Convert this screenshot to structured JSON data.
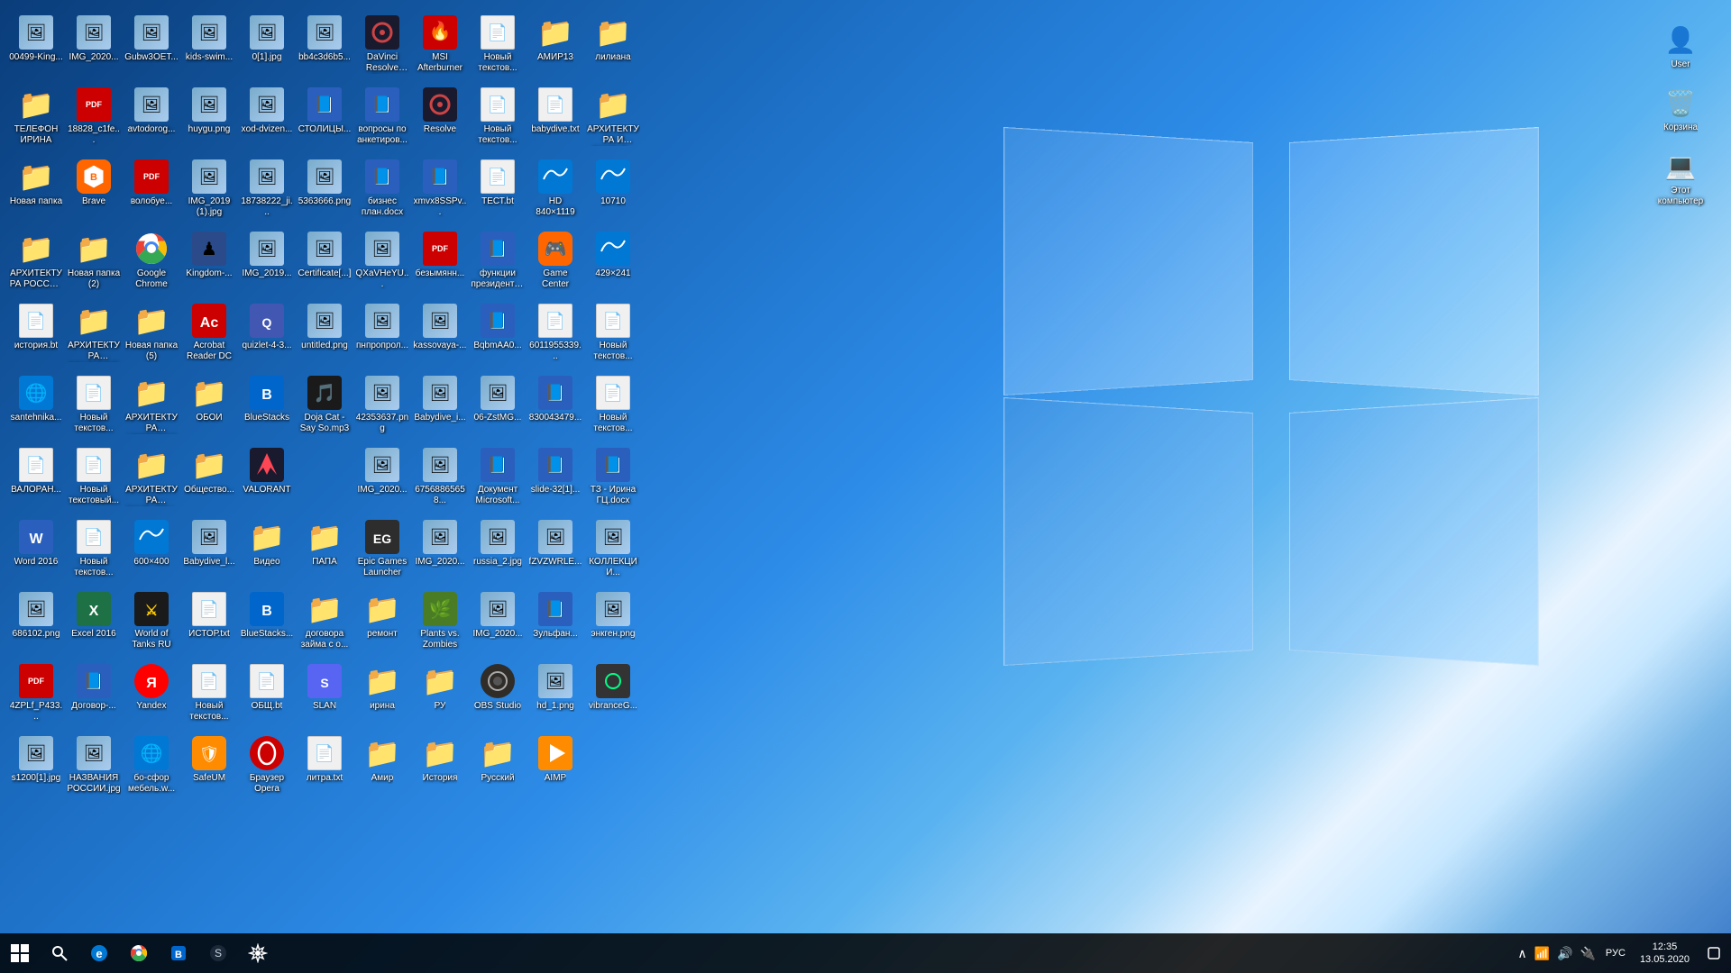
{
  "desktop": {
    "icons": [
      {
        "id": "00499-king",
        "label": "00499-King...",
        "type": "img",
        "emoji": "🖼️"
      },
      {
        "id": "img-2020-1",
        "label": "IMG_2020...",
        "type": "img",
        "emoji": "🖼️"
      },
      {
        "id": "gubw3oet",
        "label": "Gubw3OET...",
        "type": "img",
        "emoji": "🖼️"
      },
      {
        "id": "kids-swim",
        "label": "kids-swim...",
        "type": "img",
        "emoji": "🖼️"
      },
      {
        "id": "0-1-jpg",
        "label": "0[1].jpg",
        "type": "img",
        "emoji": "🖼️"
      },
      {
        "id": "bb4c3d6b",
        "label": "bb4c3d6b5...",
        "type": "img",
        "emoji": "🖼️"
      },
      {
        "id": "davinci",
        "label": "DaVinci Resolve Pro...",
        "type": "app",
        "emoji": "🎬"
      },
      {
        "id": "msi-afterburner",
        "label": "MSI Afterburner",
        "type": "app",
        "emoji": "🔥"
      },
      {
        "id": "new-txt-1",
        "label": "Новый текстов...",
        "type": "txt",
        "emoji": "📄"
      },
      {
        "id": "amir13",
        "label": "АМИР13",
        "type": "folder",
        "emoji": "📁"
      },
      {
        "id": "liliana",
        "label": "лилиана",
        "type": "folder",
        "emoji": "📁"
      },
      {
        "id": "telefon-irina",
        "label": "ТЕЛЕФОН ИРИНА",
        "type": "folder",
        "emoji": "📁"
      },
      {
        "id": "18828-c1fe",
        "label": "18828_c1fe...",
        "type": "pdf",
        "emoji": "📕"
      },
      {
        "id": "avtodorog",
        "label": "avtodorog...",
        "type": "img",
        "emoji": "🖼️"
      },
      {
        "id": "huygu",
        "label": "huygu.png",
        "type": "img",
        "emoji": "🖼️"
      },
      {
        "id": "xod-dvizen",
        "label": "xod-dvizen...",
        "type": "img",
        "emoji": "🖼️"
      },
      {
        "id": "stolicy",
        "label": "СТОЛИЦЫ...",
        "type": "docx",
        "emoji": "📘"
      },
      {
        "id": "voprosy",
        "label": "вопросы по анкетиров...",
        "type": "docx",
        "emoji": "📘"
      },
      {
        "id": "resolve",
        "label": "Resolve",
        "type": "app",
        "emoji": "🎬"
      },
      {
        "id": "new-txt-2",
        "label": "Новый текстов...",
        "type": "txt",
        "emoji": "📄"
      },
      {
        "id": "babydive-txt",
        "label": "babydive.txt",
        "type": "txt",
        "emoji": "📄"
      },
      {
        "id": "arhit-skulp",
        "label": "АРХИТЕКТУРА И СКУЛЬП...",
        "type": "folder",
        "emoji": "📁"
      },
      {
        "id": "new-folder-1",
        "label": "Новая папка",
        "type": "folder",
        "emoji": "📁"
      },
      {
        "id": "brave",
        "label": "Brave",
        "type": "app",
        "emoji": "🦁"
      },
      {
        "id": "voloboy",
        "label": "волобуе...",
        "type": "pdf",
        "emoji": "📕"
      },
      {
        "id": "img-2019-1",
        "label": "IMG_2019 (1).jpg",
        "type": "img",
        "emoji": "🖼️"
      },
      {
        "id": "18738222",
        "label": "18738222_ji...",
        "type": "img",
        "emoji": "🖼️"
      },
      {
        "id": "5363666",
        "label": "5363666.png",
        "type": "img",
        "emoji": "🖼️"
      },
      {
        "id": "biznes-plan",
        "label": "бизнес план.docx",
        "type": "docx",
        "emoji": "📘"
      },
      {
        "id": "xmvx8sspv",
        "label": "xmvx8SSPv...",
        "type": "docx",
        "emoji": "📘"
      },
      {
        "id": "test-txt",
        "label": "ТЕСТ.bt",
        "type": "txt",
        "emoji": "📄"
      },
      {
        "id": "hd840",
        "label": "HD 840×1119",
        "type": "app",
        "emoji": "🌐"
      },
      {
        "id": "10710",
        "label": "10710",
        "type": "app",
        "emoji": "🌐"
      },
      {
        "id": "arhit-russia",
        "label": "АРХИТЕКТУРА РОССИЯ И...",
        "type": "folder",
        "emoji": "📁"
      },
      {
        "id": "new-folder-2",
        "label": "Новая папка (2)",
        "type": "folder",
        "emoji": "📁"
      },
      {
        "id": "google-chrome",
        "label": "Google Chrome",
        "type": "app",
        "emoji": "🌐"
      },
      {
        "id": "kingdom",
        "label": "Kingdom-...",
        "type": "app",
        "emoji": "🎮"
      },
      {
        "id": "img-2019-2",
        "label": "IMG_2019...",
        "type": "img",
        "emoji": "🖼️"
      },
      {
        "id": "certificate",
        "label": "Certificate[...]",
        "type": "img",
        "emoji": "🖼️"
      },
      {
        "id": "qxavheyu",
        "label": "QXaVHeYU...",
        "type": "img",
        "emoji": "🖼️"
      },
      {
        "id": "bezymyan",
        "label": "безымянн...",
        "type": "pdf",
        "emoji": "📕"
      },
      {
        "id": "funktsii",
        "label": "функции президента...",
        "type": "docx",
        "emoji": "📘"
      },
      {
        "id": "game-center",
        "label": "Game Center",
        "type": "app",
        "emoji": "🎮"
      },
      {
        "id": "429x241",
        "label": "429×241",
        "type": "app",
        "emoji": "🌐"
      },
      {
        "id": "istoriya-txt",
        "label": "история.bt",
        "type": "txt",
        "emoji": "📄"
      },
      {
        "id": "arhit-vlad",
        "label": "АРХИТЕКТУРА ВЛАДИМИР",
        "type": "folder",
        "emoji": "📁"
      },
      {
        "id": "new-folder-5",
        "label": "Новая папка (5)",
        "type": "folder",
        "emoji": "📁"
      },
      {
        "id": "acrobat-dc",
        "label": "Acrobat Reader DC",
        "type": "app",
        "emoji": "📕"
      },
      {
        "id": "quizlet",
        "label": "quizlet-4-3...",
        "type": "app",
        "emoji": "🎓"
      },
      {
        "id": "untitled",
        "label": "untitled.png",
        "type": "img",
        "emoji": "🖼️"
      },
      {
        "id": "pnproprol",
        "label": "пнпропрол...",
        "type": "img",
        "emoji": "🖼️"
      },
      {
        "id": "kassovaya",
        "label": "kassovaya-...",
        "type": "img",
        "emoji": "🖼️"
      },
      {
        "id": "bqbmaa40",
        "label": "BqbmAA0...",
        "type": "docx",
        "emoji": "📘"
      },
      {
        "id": "6011955339",
        "label": "6011955339...",
        "type": "txt",
        "emoji": "📄"
      },
      {
        "id": "new-txt-3",
        "label": "Новый текстов...",
        "type": "txt",
        "emoji": "📄"
      },
      {
        "id": "santehnika",
        "label": "santehnika...",
        "type": "app",
        "emoji": "🌐"
      },
      {
        "id": "new-txt-4",
        "label": "Новый текстов...",
        "type": "txt",
        "emoji": "📄"
      },
      {
        "id": "arhit-novg",
        "label": "АРХИТЕКТУРА НОВГОРОД",
        "type": "folder",
        "emoji": "📁"
      },
      {
        "id": "oboi",
        "label": "ОБОИ",
        "type": "folder",
        "emoji": "📁"
      },
      {
        "id": "bluestacks-1",
        "label": "BlueStacks",
        "type": "app",
        "emoji": "📱"
      },
      {
        "id": "doja-cat",
        "label": "Doja Cat - Say So.mp3",
        "type": "app",
        "emoji": "🎵"
      },
      {
        "id": "42353637",
        "label": "42353637.png",
        "type": "img",
        "emoji": "🖼️"
      },
      {
        "id": "babydive-img",
        "label": "Babydive_i...",
        "type": "img",
        "emoji": "🖼️"
      },
      {
        "id": "06-zstmg",
        "label": "06-ZstMG...",
        "type": "img",
        "emoji": "🖼️"
      },
      {
        "id": "830043479",
        "label": "830043479...",
        "type": "docx",
        "emoji": "📘"
      },
      {
        "id": "new-txt-5",
        "label": "Новый текстов...",
        "type": "txt",
        "emoji": "📄"
      },
      {
        "id": "valorant-txt",
        "label": "ВАЛОРАН...",
        "type": "txt",
        "emoji": "📄"
      },
      {
        "id": "new-txt-6",
        "label": "Новый текстовый...",
        "type": "txt",
        "emoji": "📄"
      },
      {
        "id": "arhit-skulp2",
        "label": "АРХИТЕКТУРА СКУЛЬПТУ...",
        "type": "folder",
        "emoji": "📁"
      },
      {
        "id": "obshchestvo",
        "label": "Общество...",
        "type": "folder",
        "emoji": "📁"
      },
      {
        "id": "valorant",
        "label": "VALORANT",
        "type": "app",
        "emoji": "🎮"
      },
      {
        "id": "empty-1",
        "label": "",
        "type": "empty",
        "emoji": ""
      },
      {
        "id": "img-2020-2",
        "label": "IMG_2020...",
        "type": "img",
        "emoji": "🖼️"
      },
      {
        "id": "67568",
        "label": "67568865658...",
        "type": "img",
        "emoji": "🖼️"
      },
      {
        "id": "dokument",
        "label": "Документ Microsoft...",
        "type": "docx",
        "emoji": "📘"
      },
      {
        "id": "slide-32",
        "label": "slide-32[1]...",
        "type": "docx",
        "emoji": "📘"
      },
      {
        "id": "tz-irina",
        "label": "ТЗ - Ирина ГЦ.docx",
        "type": "docx",
        "emoji": "📘"
      },
      {
        "id": "word-2016",
        "label": "Word 2016",
        "type": "app",
        "emoji": "📘"
      },
      {
        "id": "new-txt-7",
        "label": "Новый текстов...",
        "type": "txt",
        "emoji": "📄"
      },
      {
        "id": "600x400",
        "label": "600×400",
        "type": "app",
        "emoji": "🌐"
      },
      {
        "id": "babydive-l",
        "label": "Babydive_l...",
        "type": "img",
        "emoji": "🖼️"
      },
      {
        "id": "video",
        "label": "Видео",
        "type": "folder",
        "emoji": "📁"
      },
      {
        "id": "papa",
        "label": "ПАПА",
        "type": "folder",
        "emoji": "📁"
      },
      {
        "id": "epic-games",
        "label": "Epic Games Launcher",
        "type": "app",
        "emoji": "🎮"
      },
      {
        "id": "img-2020-3",
        "label": "IMG_2020...",
        "type": "img",
        "emoji": "🖼️"
      },
      {
        "id": "russia-2",
        "label": "russia_2.jpg",
        "type": "img",
        "emoji": "🖼️"
      },
      {
        "id": "fzvzwr",
        "label": "fZVZWRLE...",
        "type": "img",
        "emoji": "🖼️"
      },
      {
        "id": "kollekcii",
        "label": "КОЛЛЕКЦИИ...",
        "type": "img",
        "emoji": "🖼️"
      },
      {
        "id": "686102",
        "label": "686102.png",
        "type": "img",
        "emoji": "🖼️"
      },
      {
        "id": "excel-2016",
        "label": "Excel 2016",
        "type": "app",
        "emoji": "📗"
      },
      {
        "id": "world-of-tanks",
        "label": "World of Tanks RU",
        "type": "app",
        "emoji": "🎮"
      },
      {
        "id": "istor-txt",
        "label": "ИСТОР.txt",
        "type": "txt",
        "emoji": "📄"
      },
      {
        "id": "bluestacks-app",
        "label": "BlueStacks...",
        "type": "app",
        "emoji": "📱"
      },
      {
        "id": "dogovor-zaym",
        "label": "договора займа с о...",
        "type": "folder",
        "emoji": "📁"
      },
      {
        "id": "remont",
        "label": "ремонт",
        "type": "folder",
        "emoji": "📁"
      },
      {
        "id": "plants-vs-zombies",
        "label": "Plants vs. Zombies",
        "type": "app",
        "emoji": "🌿"
      },
      {
        "id": "img-2020-4",
        "label": "IMG_2020...",
        "type": "img",
        "emoji": "🖼️"
      },
      {
        "id": "zulfan",
        "label": "Зульфан...",
        "type": "docx",
        "emoji": "📘"
      },
      {
        "id": "enkgen",
        "label": "энкген.png",
        "type": "img",
        "emoji": "🖼️"
      },
      {
        "id": "4zplf-p433",
        "label": "4ZPLf_P433...",
        "type": "pdf",
        "emoji": "📕"
      },
      {
        "id": "dogovor",
        "label": "Договор-...",
        "type": "docx",
        "emoji": "📘"
      },
      {
        "id": "yandex",
        "label": "Yandex",
        "type": "app",
        "emoji": "🔍"
      },
      {
        "id": "new-txt-8",
        "label": "Новый текстов...",
        "type": "txt",
        "emoji": "📄"
      },
      {
        "id": "obshch-txt",
        "label": "ОБЩ.bt",
        "type": "txt",
        "emoji": "📄"
      },
      {
        "id": "slan",
        "label": "SLAN",
        "type": "app",
        "emoji": "💬"
      },
      {
        "id": "irina",
        "label": "ирина",
        "type": "folder",
        "emoji": "📁"
      },
      {
        "id": "ru",
        "label": "РУ",
        "type": "folder",
        "emoji": "📁"
      },
      {
        "id": "obs-studio",
        "label": "OBS Studio",
        "type": "app",
        "emoji": "🎥"
      },
      {
        "id": "hd-1",
        "label": "hd_1.png",
        "type": "img",
        "emoji": "🖼️"
      },
      {
        "id": "vibranceg",
        "label": "vibranceG...",
        "type": "app",
        "emoji": "⚙️"
      },
      {
        "id": "s1200-1",
        "label": "s1200[1].jpg",
        "type": "img",
        "emoji": "🖼️"
      },
      {
        "id": "nazvaniya-rossii",
        "label": "НАЗВАНИЯ РОСCИИ.jpg",
        "type": "img",
        "emoji": "🖼️"
      },
      {
        "id": "bosforum",
        "label": "бо-сфор мебель.w...",
        "type": "app",
        "emoji": "🌐"
      },
      {
        "id": "safeum",
        "label": "SafeUM",
        "type": "app",
        "emoji": "💬"
      },
      {
        "id": "opera",
        "label": "Браузер Opera",
        "type": "app",
        "emoji": "🔴"
      },
      {
        "id": "litra-txt",
        "label": "литра.txt",
        "type": "txt",
        "emoji": "📄"
      },
      {
        "id": "amir-folder",
        "label": "Амир",
        "type": "folder",
        "emoji": "📁"
      },
      {
        "id": "istoriya",
        "label": "История",
        "type": "folder",
        "emoji": "📁"
      },
      {
        "id": "russkiy",
        "label": "Русский",
        "type": "folder",
        "emoji": "📁"
      },
      {
        "id": "aimp",
        "label": "AIMP",
        "type": "app",
        "emoji": "🎵"
      }
    ],
    "right_icons": [
      {
        "id": "user",
        "label": "User",
        "type": "folder",
        "emoji": "👤"
      },
      {
        "id": "korzina",
        "label": "Корзина",
        "type": "app",
        "emoji": "🗑️"
      },
      {
        "id": "this-pc",
        "label": "Этот компьютер",
        "type": "app",
        "emoji": "💻"
      }
    ]
  },
  "taskbar": {
    "start_label": "⊞",
    "search_label": "🔍",
    "pinned": [
      {
        "id": "edge",
        "emoji": "🌐",
        "label": "Microsoft Edge"
      },
      {
        "id": "chrome-task",
        "emoji": "🔵",
        "label": "Google Chrome"
      },
      {
        "id": "bluestacks-task",
        "emoji": "📱",
        "label": "BlueStacks"
      },
      {
        "id": "steam",
        "emoji": "🎮",
        "label": "Steam"
      },
      {
        "id": "settings",
        "emoji": "⚙️",
        "label": "Settings"
      }
    ],
    "tray": {
      "show_hidden": "∧",
      "icons": [
        "📶",
        "🔊",
        "🔌"
      ],
      "action_center": "💬"
    },
    "language": "РУС",
    "time": "12:35",
    "date": "13.05.2020"
  }
}
